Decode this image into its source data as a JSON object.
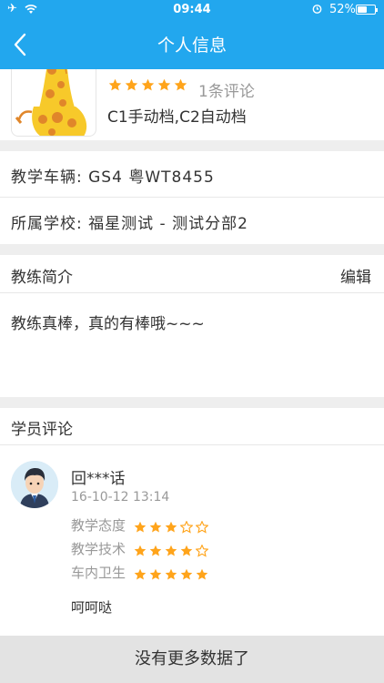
{
  "status_bar": {
    "time": "09:44",
    "battery": "52%"
  },
  "nav": {
    "title": "个人信息"
  },
  "profile": {
    "rating_stars": 5,
    "review_count": "1条评论",
    "license": "C1手动档,C2自动档"
  },
  "info": {
    "vehicle": "教学车辆: GS4 粤WT8455",
    "school": "所属学校: 福星测试 - 测试分部2"
  },
  "intro": {
    "heading": "教练简介",
    "edit_label": "编辑",
    "text": "教练真棒，真的有棒哦~~~"
  },
  "comments": {
    "heading": "学员评论",
    "items": [
      {
        "user": "回***话",
        "time": "16-10-12 13:14",
        "ratings": [
          {
            "label": "教学态度",
            "stars": 3
          },
          {
            "label": "教学技术",
            "stars": 4
          },
          {
            "label": "车内卫生",
            "stars": 5
          }
        ],
        "body": "呵呵哒"
      }
    ]
  },
  "footer": {
    "text": "没有更多数据了"
  },
  "colors": {
    "accent": "#22a7ee",
    "star": "#ffa41b"
  }
}
